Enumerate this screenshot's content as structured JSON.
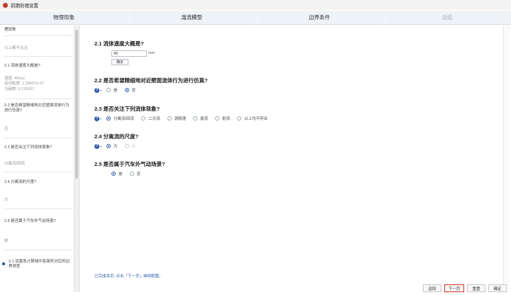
{
  "window": {
    "title": "前期处理设置"
  },
  "steps": [
    {
      "label": "物理现象"
    },
    {
      "label": "湍流模型"
    },
    {
      "label": "边界条件"
    },
    {
      "label": "总结"
    }
  ],
  "sidebar": {
    "items": [
      {
        "text": "理现象",
        "kind": "q"
      },
      {
        "text": "以上都不关注",
        "kind": "a"
      },
      {
        "text": "2.1 流体速度大概是?",
        "kind": "q"
      },
      {
        "text": "速度: 40m/s\n运动粘度: 1.29437e-07\n马赫数: 0.115607",
        "kind": "a"
      },
      {
        "text": "2.2 是否希望精细地对近壁面流体行为进行仿真?",
        "kind": "q"
      },
      {
        "text": "否",
        "kind": "a"
      },
      {
        "text": "2.3 是否关注下列流体现象?",
        "kind": "q"
      },
      {
        "text": "分离流/回流",
        "kind": "a"
      },
      {
        "text": "2.4 分离流的尺度?",
        "kind": "q"
      },
      {
        "text": "大",
        "kind": "a"
      },
      {
        "text": "2.5 是否属于汽车外气动场景?",
        "kind": "q"
      },
      {
        "text": "是",
        "kind": "a"
      },
      {
        "text": "3.1 设置各计算域中各面所对应的边界类型",
        "kind": "q"
      }
    ]
  },
  "questions": {
    "q1": {
      "title": "2.1 流体速度大概是?",
      "value": "40",
      "unit": "m/s",
      "confirm": "确定"
    },
    "q2": {
      "title": "2.2 是否希望精细地对近壁面流体行为进行仿真?",
      "options": [
        "是",
        "否"
      ],
      "selected": "否"
    },
    "q3": {
      "title": "2.3 是否关注下列流体现象?",
      "options": [
        "分离流/回流",
        "二次流",
        "涡脱落",
        "旋流",
        "射流",
        "以上均不符合"
      ],
      "selected": "分离流/回流"
    },
    "q4": {
      "title": "2.4 分离流的尺度?",
      "options": [
        "大",
        "小"
      ],
      "selected": "大"
    },
    "q5": {
      "title": "2.5 是否属于汽车外气动场景?",
      "options": [
        "是",
        "否"
      ],
      "selected": "是"
    }
  },
  "status": "已完成本页, 点击「下一页」继续配置。",
  "buttons": {
    "back": "返回",
    "next": "下一页",
    "reset": "重置",
    "ok": "确定"
  },
  "colors": {
    "accent": "#2d5fa8",
    "highlight_border": "#d0342c"
  }
}
